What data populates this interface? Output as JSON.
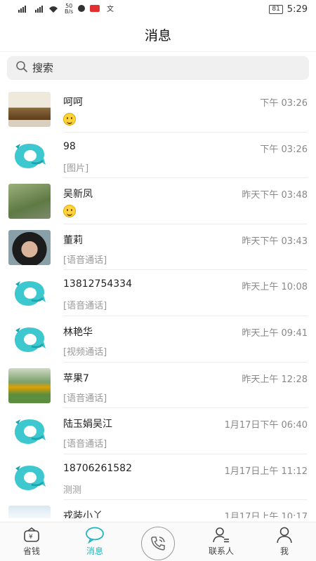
{
  "status_bar": {
    "speed": "50\nB/s",
    "battery": "81",
    "time": "5:29"
  },
  "header": {
    "title": "消息"
  },
  "search": {
    "placeholder": "搜索"
  },
  "conversations": [
    {
      "name": "呵呵",
      "time": "下午 03:26",
      "preview": "",
      "has_emoji": true,
      "avatar": "photo-items"
    },
    {
      "name": "98",
      "time": "下午 03:26",
      "preview": "[图片]",
      "has_emoji": false,
      "avatar": "app-logo"
    },
    {
      "name": "吴新凤",
      "time": "昨天下午 03:48",
      "preview": "",
      "has_emoji": true,
      "avatar": "photo-woman-hat"
    },
    {
      "name": "董莉",
      "time": "昨天下午 03:43",
      "preview": "[语音通话]",
      "has_emoji": false,
      "avatar": "photo-portrait"
    },
    {
      "name": "13812754334",
      "time": "昨天上午 10:08",
      "preview": "[语音通话]",
      "has_emoji": false,
      "avatar": "app-logo"
    },
    {
      "name": "林艳华",
      "time": "昨天上午 09:41",
      "preview": "[视频通话]",
      "has_emoji": false,
      "avatar": "app-logo"
    },
    {
      "name": "苹果7",
      "time": "昨天上午 12:28",
      "preview": "[语音通话]",
      "has_emoji": false,
      "avatar": "photo-playground"
    },
    {
      "name": "陆玉娟吴江",
      "time": "1月17日下午 06:40",
      "preview": "[语音通话]",
      "has_emoji": false,
      "avatar": "app-logo"
    },
    {
      "name": "18706261582",
      "time": "1月17日上午 11:12",
      "preview": "测测",
      "has_emoji": false,
      "avatar": "app-logo"
    },
    {
      "name": "戎装小丫",
      "time": "1月17日上午 10:17",
      "preview": "",
      "has_emoji": false,
      "avatar": "photo-screenshot"
    }
  ],
  "tabs": [
    {
      "label": "省钱",
      "icon": "wallet-icon",
      "active": false
    },
    {
      "label": "消息",
      "icon": "chat-bubble-icon",
      "active": true
    },
    {
      "label": "",
      "icon": "phone-call-icon",
      "active": false
    },
    {
      "label": "联系人",
      "icon": "contacts-icon",
      "active": false
    },
    {
      "label": "我",
      "icon": "person-icon",
      "active": false
    }
  ],
  "colors": {
    "accent": "#22b5c0",
    "logo_teal": "#3dc8cf",
    "logo_dark": "#1aa5b0"
  }
}
